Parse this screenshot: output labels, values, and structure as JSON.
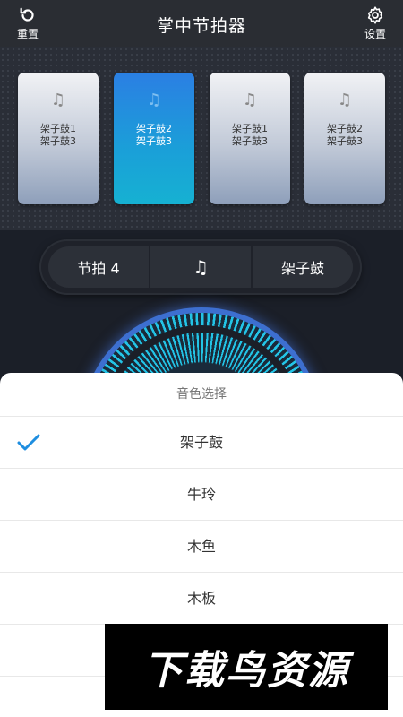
{
  "header": {
    "reset_label": "重置",
    "title": "掌中节拍器",
    "settings_label": "设置"
  },
  "cards": [
    {
      "note": "♫",
      "line1": "架子鼓1",
      "line2": "架子鼓3",
      "active": false
    },
    {
      "note": "♫",
      "line1": "架子鼓2",
      "line2": "架子鼓3",
      "active": true
    },
    {
      "note": "♫",
      "line1": "架子鼓1",
      "line2": "架子鼓3",
      "active": false
    },
    {
      "note": "♫",
      "line1": "架子鼓2",
      "line2": "架子鼓3",
      "active": false
    }
  ],
  "controls": {
    "beat_label": "节拍 4",
    "note_symbol": "♫",
    "sound_label": "架子鼓"
  },
  "sheet": {
    "title": "音色选择",
    "options": [
      {
        "label": "架子鼓",
        "selected": true
      },
      {
        "label": "牛玲",
        "selected": false
      },
      {
        "label": "木鱼",
        "selected": false
      },
      {
        "label": "木板",
        "selected": false
      }
    ]
  },
  "watermark": "下载鸟资源",
  "colors": {
    "accent": "#1e8ee0",
    "header_bg": "#2a2d33",
    "dial_ring": "#3d6fd0"
  }
}
